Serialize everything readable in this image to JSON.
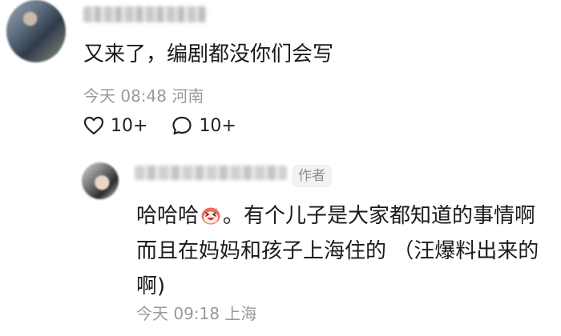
{
  "comment": {
    "text": "又来了，编剧都没你们会写",
    "time": "今天 08:48",
    "location": "河南",
    "likes": "10+",
    "replies": "10+"
  },
  "reply": {
    "author_badge": "作者",
    "text_before_emoji": "哈哈哈",
    "emoji": "laughing-face-emoji",
    "text_after_emoji": "。有个儿子是大家都知道的事情啊而且在妈妈和孩子上海住的 （汪爆料出来的啊)",
    "time": "今天 09:18",
    "location": "上海"
  },
  "colors": {
    "meta": "#9a9a9a",
    "text": "#1a1a1a",
    "emoji_face": "#f26b5b"
  }
}
